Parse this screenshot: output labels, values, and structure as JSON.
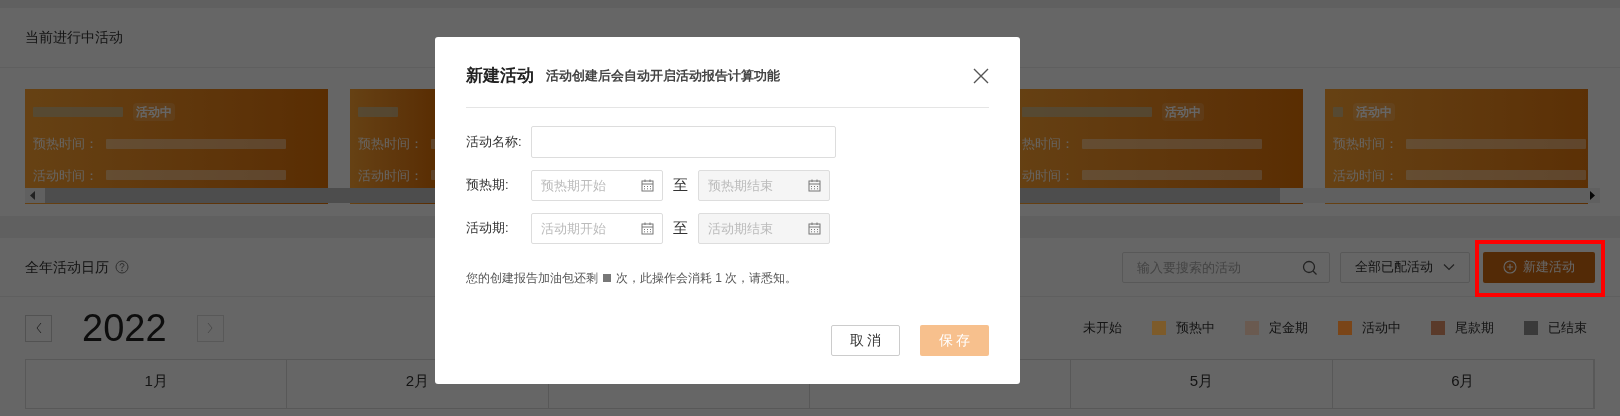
{
  "current_section": {
    "title": "当前进行中活动",
    "cards": [
      {
        "status": "活动中",
        "warmup_label": "预热时间：",
        "active_label": "活动时间："
      },
      {
        "warmup_label": "预热时间：",
        "active_label": "活动时间："
      },
      {
        "status": "活动中",
        "warmup_label": "热时间：",
        "active_label": "动时间："
      },
      {
        "status": "活动中",
        "warmup_label": "预热时间：",
        "active_label": "活动时间："
      }
    ]
  },
  "calendar_section": {
    "title": "全年活动日历",
    "search": {
      "placeholder": "输入要搜索的活动"
    },
    "filter": {
      "value": "全部已配活动"
    },
    "new_button": {
      "label": "新建活动",
      "highlighted": true
    },
    "year": "2022",
    "legend": [
      {
        "label": "未开始"
      },
      {
        "label": "预热中",
        "color": "#7d5b2a"
      },
      {
        "label": "定金期",
        "color": "#6a5a50"
      },
      {
        "label": "活动中",
        "color": "#7a4518"
      },
      {
        "label": "尾款期",
        "color": "#5a3a2a"
      },
      {
        "label": "已结束",
        "color": "#3a3a3a"
      }
    ],
    "months": [
      "1月",
      "2月",
      "5月",
      "6月"
    ]
  },
  "dialog": {
    "title": "新建活动",
    "subtitle": "活动创建后会自动开启活动报告计算功能",
    "name_field": {
      "label": "活动名称:"
    },
    "ranges": [
      {
        "label": "预热期:",
        "start": {
          "placeholder": "预热期开始"
        },
        "separator": "至",
        "end": {
          "placeholder": "预热期结束",
          "disabled": true
        }
      },
      {
        "label": "活动期:",
        "start": {
          "placeholder": "活动期开始"
        },
        "separator": "至",
        "end": {
          "placeholder": "活动期结束",
          "disabled": true
        }
      }
    ],
    "note": {
      "before": "您的创建报告加油包还剩",
      "masked": true,
      "after": "次，此操作会消耗 1 次，请悉知。"
    },
    "buttons": [
      {
        "label": "取 消",
        "kind": "secondary"
      },
      {
        "label": "保 存",
        "kind": "primary",
        "disabled": true
      }
    ]
  }
}
